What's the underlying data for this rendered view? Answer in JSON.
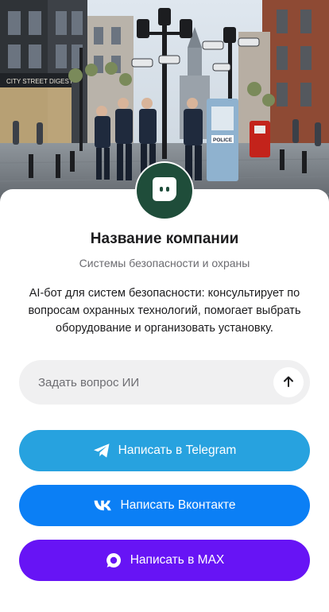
{
  "hero": {
    "image": "city-security-illustration",
    "signs": {
      "police_booth": "POLICE",
      "storefront": "CITY STREET DIGEST"
    }
  },
  "logo": {
    "icon": "chat-bubble-icon",
    "color": "#1f4d3a"
  },
  "company": {
    "name": "Название компании",
    "category": "Системы безопасности и охраны",
    "description": "AI-бот для систем безопасности: консультирует по вопросам охранных технологий, помогает выбрать оборудование и организовать установку."
  },
  "ask": {
    "placeholder": "Задать вопрос ИИ",
    "value": "",
    "send_icon": "arrow-up-icon"
  },
  "buttons": {
    "telegram": {
      "label": "Написать в Telegram",
      "icon": "telegram-icon",
      "color": "#27a2df"
    },
    "vk": {
      "label": "Написать Вконтакте",
      "icon": "vk-icon",
      "color": "#0b7ff5"
    },
    "max": {
      "label": "Написать в MAX",
      "icon": "max-icon",
      "color": "#6714f5"
    }
  }
}
